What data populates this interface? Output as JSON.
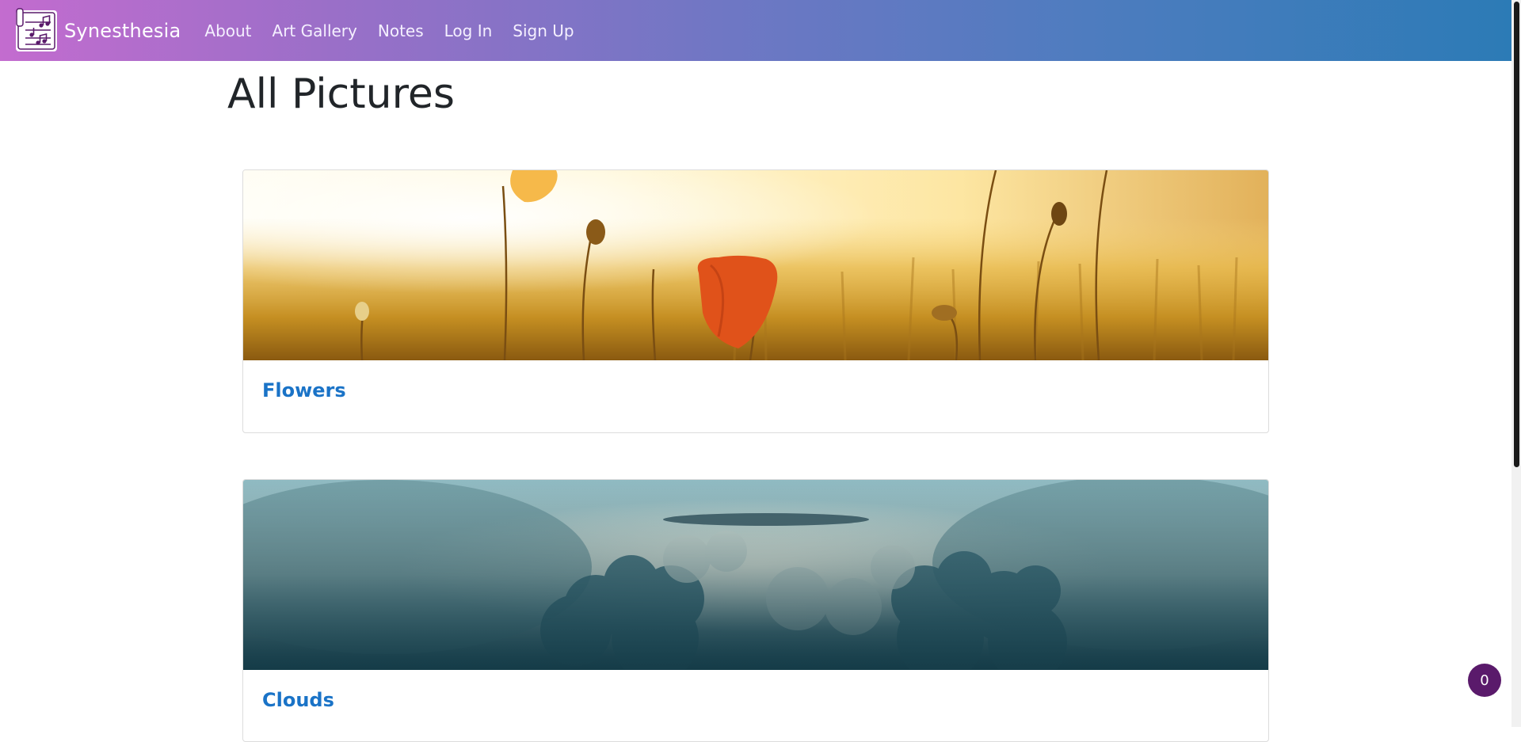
{
  "navbar": {
    "brand": "Synesthesia",
    "links": [
      "About",
      "Art Gallery",
      "Notes",
      "Log In",
      "Sign Up"
    ]
  },
  "page": {
    "title": "All Pictures"
  },
  "cards": [
    {
      "title": "Flowers",
      "image_icon": "poppy-field-image"
    },
    {
      "title": "Clouds",
      "image_icon": "cloudscape-image"
    }
  ],
  "badge": {
    "count": "0"
  },
  "colors": {
    "nav_gradient_start": "#c36ccf",
    "nav_gradient_end": "#2c7bb6",
    "link_blue": "#1a73c7",
    "badge_purple": "#5a1a6b"
  }
}
